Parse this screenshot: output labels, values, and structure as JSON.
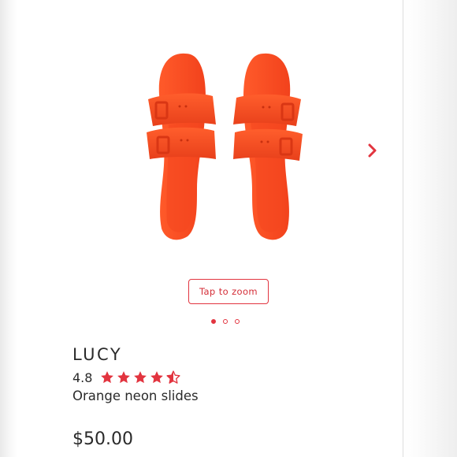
{
  "product": {
    "name": "LUCY",
    "rating": "4.8",
    "rating_stars": 4.5,
    "description": "Orange neon slides",
    "price": "$50.00",
    "image_icon": "orange-slide-sandals-image",
    "accent_color": "#e2343f",
    "product_color": "#ff4a1e"
  },
  "gallery": {
    "zoom_label": "Tap to zoom",
    "next_icon": "chevron-right-icon",
    "dots": [
      "active",
      "inactive",
      "inactive"
    ]
  }
}
